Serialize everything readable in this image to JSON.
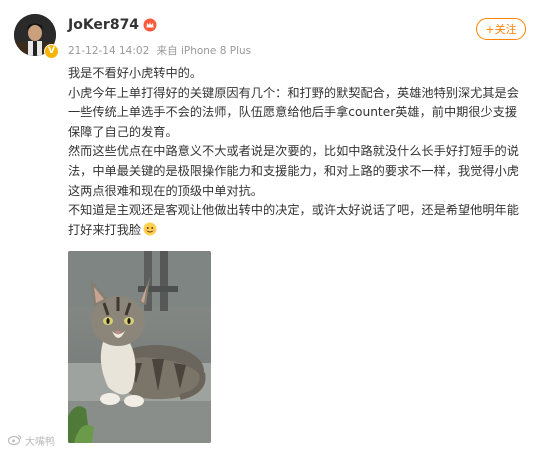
{
  "post": {
    "author": "JoKer874",
    "timestamp": "21-12-14 14:02",
    "source": "来自 iPhone 8 Plus",
    "follow_label": "+关注",
    "paragraphs": [
      "我是不看好小虎转中的。",
      "小虎今年上单打得好的关键原因有几个：和打野的默契配合，英雄池特别深尤其是会一些传统上单选手不会的法师，队伍愿意给他后手拿counter英雄，前中期很少支援保障了自己的发育。",
      "然而这些优点在中路意义不大或者说是次要的，比如中路就没什么长手好打短手的说法，中单最关键的是极限操作能力和支援能力，和对上路的要求不一样，我觉得小虎这两点很难和现在的顶级中单对抗。",
      "不知道是主观还是客观让他做出转中的决定，或许太好说话了吧，还是希望他明年能打好来打我脸"
    ],
    "emoji_name": "face-emoji"
  },
  "watermark": {
    "text": "大嘴鸭"
  },
  "colors": {
    "accent": "#ff8200",
    "text": "#333333",
    "meta": "#999999"
  }
}
